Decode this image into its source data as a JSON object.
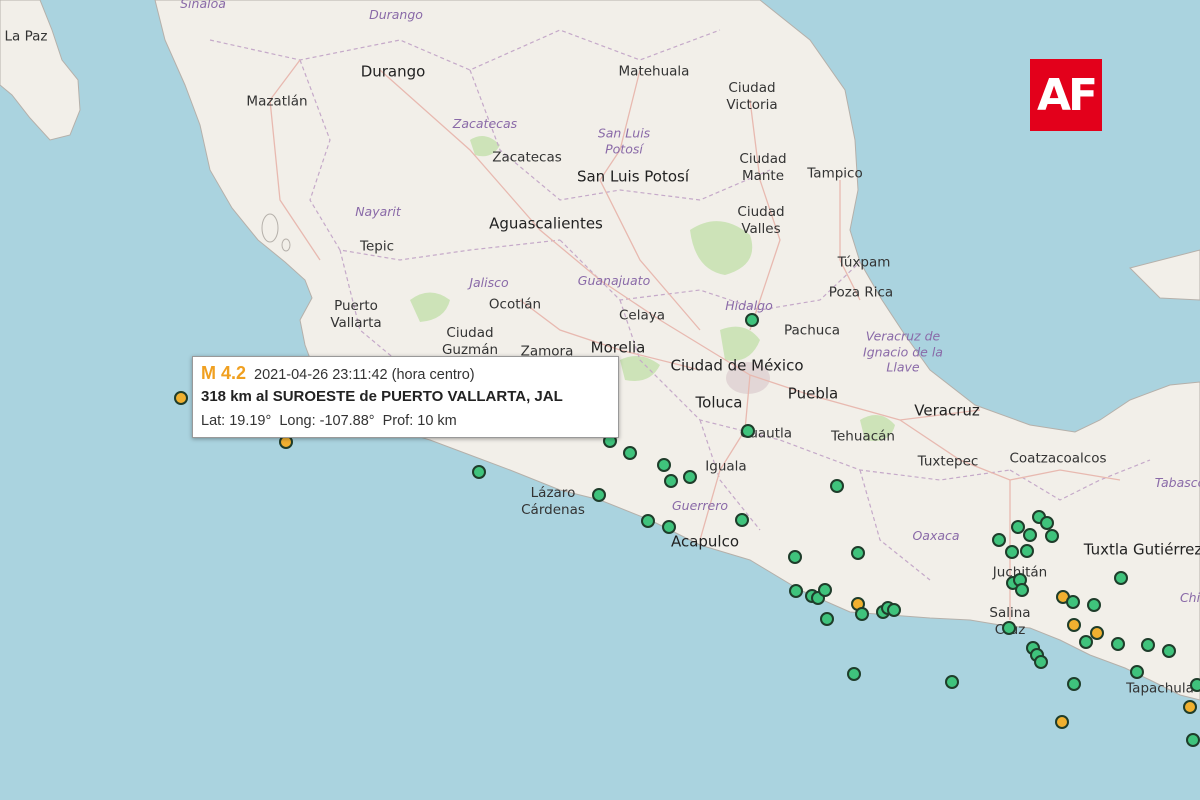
{
  "logo": {
    "text": "AF",
    "color": "#e3001b"
  },
  "colors": {
    "water": "#aad3df",
    "land": "#f2efe9",
    "quake_small": "#3fc37c",
    "quake_medium": "#f0b030"
  },
  "state_labels": [
    "Sinaloa",
    "Durango",
    "Zacatecas",
    "San Luis Potosí",
    "Nayarit",
    "Jalisco",
    "Guanajuato",
    "Hidalgo",
    "Veracruz de Ignacio de la Llave",
    "Guerrero",
    "Oaxaca",
    "Tabasco",
    "Chi"
  ],
  "city_labels": [
    "La Paz",
    "Durango",
    "Mazatlán",
    "Matehuala",
    "Ciudad Victoria",
    "Zacatecas",
    "San Luis Potosí",
    "Ciudad Mante",
    "Tampico",
    "Aguascalientes",
    "Ciudad Valles",
    "Tepic",
    "Túxpam",
    "Poza Rica",
    "Puerto Vallarta",
    "Ocotlán",
    "Celaya",
    "Pachuca",
    "Ciudad Guzmán",
    "Zamora",
    "Morelia",
    "Ciudad de México",
    "Puebla",
    "Toluca",
    "Veracruz",
    "Cuautla",
    "Tehuacán",
    "Iguala",
    "Tuxtepec",
    "Coatzacoalcos",
    "Lázaro Cárdenas",
    "Acapulco",
    "Tuxtla Gutiérrez",
    "Juchitán",
    "Salina Cruz",
    "Tapachula"
  ],
  "popup": {
    "magnitude": "M 4.2",
    "datetime": "2021-04-26  23:11:42 (hora centro)",
    "location": "318 km al SUROESTE de PUERTO VALLARTA, JAL",
    "lat": "Lat: 19.19°",
    "long": "Long: -107.88°",
    "depth": "Prof: 10 km"
  }
}
